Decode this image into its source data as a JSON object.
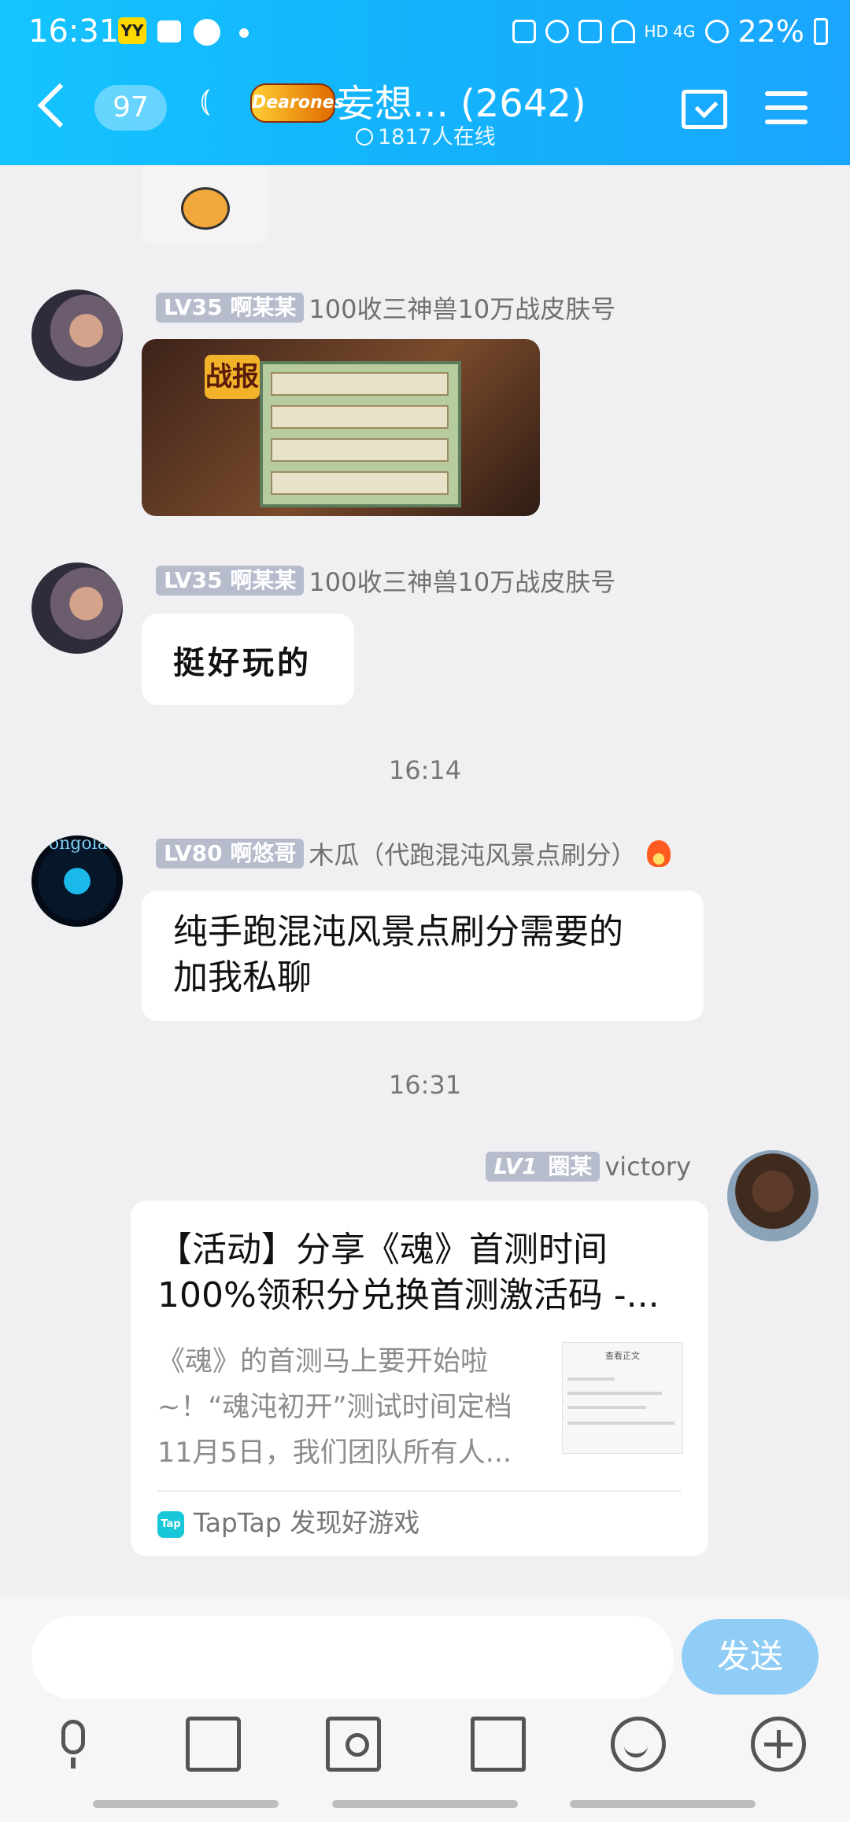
{
  "status_bar": {
    "time": "16:31",
    "battery": "22%",
    "network": "HD 4G"
  },
  "header": {
    "unread_count": "97",
    "group_logo_text": "Dearones",
    "title": "妄想...  (2642)",
    "online": "1817人在线"
  },
  "messages": [
    {
      "level": "LV35",
      "nickname": "啊某某",
      "group_title": "100收三神兽10万战皮肤号",
      "type": "image"
    },
    {
      "level": "LV35",
      "nickname": "啊某某",
      "group_title": "100收三神兽10万战皮肤号",
      "type": "text",
      "text": "挺好玩的"
    },
    {
      "type": "timestamp",
      "text": "16:14"
    },
    {
      "level": "LV80",
      "nickname": "啊悠哥",
      "group_title": "木瓜（代跑混沌风景点刷分）",
      "type": "text",
      "text": "纯手跑混沌风景点刷分需要的\n加我私聊"
    },
    {
      "type": "timestamp",
      "text": "16:31"
    },
    {
      "level": "LV1",
      "nickname": "圈某",
      "group_title": "victory",
      "type": "share_card",
      "card": {
        "title": "【活动】分享《魂》首测时间\n100%领积分兑换首测激活码 -...",
        "description": "《魂》的首测马上要开始啦\n~！“魂沌初开”测试时间定档\n11月5日，我们团队所有人...",
        "thumb_title": "查看正文",
        "source": "TapTap 发现好游戏",
        "source_icon": "Tap"
      }
    }
  ],
  "image_message": {
    "badge_text": "战报"
  },
  "input": {
    "placeholder": "",
    "send_label": "发送"
  }
}
